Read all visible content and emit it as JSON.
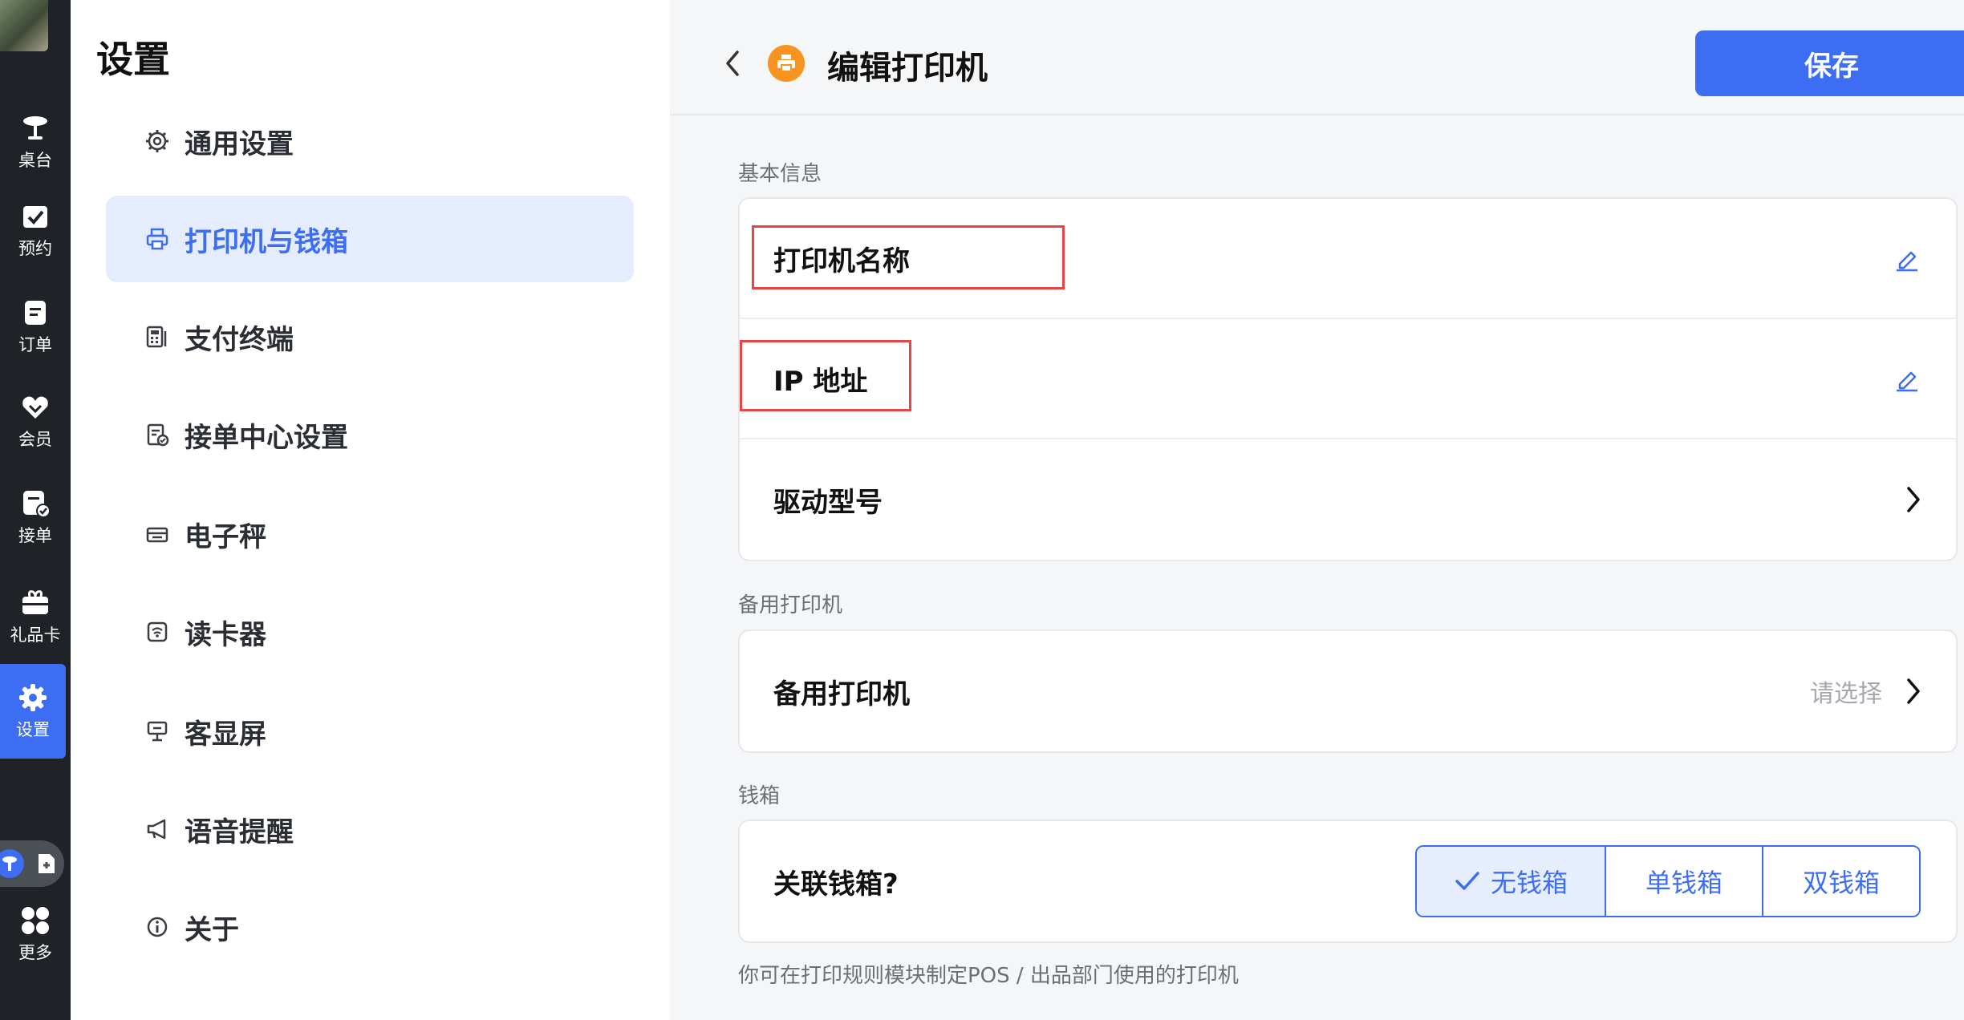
{
  "rail": {
    "items": [
      {
        "label": "桌台",
        "icon": "table-icon"
      },
      {
        "label": "预约",
        "icon": "reservation-icon"
      },
      {
        "label": "订单",
        "icon": "order-icon"
      },
      {
        "label": "会员",
        "icon": "member-icon"
      },
      {
        "label": "接单",
        "icon": "accept-order-icon"
      },
      {
        "label": "礼品卡",
        "icon": "gift-card-icon"
      },
      {
        "label": "设置",
        "icon": "gear-icon"
      },
      {
        "label": "更多",
        "icon": "more-grid-icon"
      }
    ]
  },
  "menu": {
    "title": "设置",
    "items": [
      {
        "label": "通用设置",
        "icon": "gear-icon"
      },
      {
        "label": "打印机与钱箱",
        "icon": "printer-icon"
      },
      {
        "label": "支付终端",
        "icon": "payment-terminal-icon"
      },
      {
        "label": "接单中心设置",
        "icon": "order-center-icon"
      },
      {
        "label": "电子秤",
        "icon": "scale-icon"
      },
      {
        "label": "读卡器",
        "icon": "card-reader-icon"
      },
      {
        "label": "客显屏",
        "icon": "customer-display-icon"
      },
      {
        "label": "语音提醒",
        "icon": "megaphone-icon"
      },
      {
        "label": "关于",
        "icon": "info-icon"
      }
    ]
  },
  "header": {
    "title": "编辑打印机",
    "save_label": "保存"
  },
  "basic": {
    "section_label": "基本信息",
    "printer_name_label": "打印机名称",
    "ip_label": "IP 地址",
    "driver_label": "驱动型号"
  },
  "backup": {
    "section_label": "备用打印机",
    "label": "备用打印机",
    "placeholder": "请选择"
  },
  "cashbox": {
    "section_label": "钱箱",
    "question": "关联钱箱?",
    "options": [
      "无钱箱",
      "单钱箱",
      "双钱箱"
    ],
    "selected": "无钱箱"
  },
  "footer_note": "你可在打印规则模块制定POS / 出品部门使用的打印机",
  "colors": {
    "accent": "#3d6df2",
    "rail_bg": "#1f2226",
    "badge": "#f7931e",
    "highlight_box": "#e64545"
  }
}
